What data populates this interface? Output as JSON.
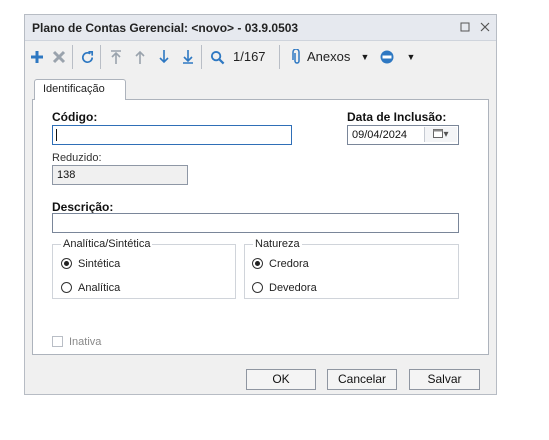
{
  "window": {
    "title": "Plano de Contas Gerencial: <novo> - 03.9.0503"
  },
  "titlebar": {
    "maximize_icon": "maximize-icon",
    "close_icon": "close-icon"
  },
  "toolbar": {
    "record_counter": "1/167",
    "attachments_label": "Anexos",
    "icons": [
      "add-icon",
      "delete-icon",
      "refresh-icon",
      "first-icon",
      "previous-icon",
      "next-icon",
      "last-icon",
      "search-icon",
      "paperclip-icon",
      "dropdown-icon",
      "report-icon",
      "dropdown-icon"
    ],
    "colors": {
      "add": "#2e78c2",
      "nav": "#2e78c2",
      "delete": "#9aa3ad"
    }
  },
  "tabs": [
    {
      "label": "Identificação",
      "active": true
    }
  ],
  "form": {
    "codigo": {
      "label": "Código:",
      "value": ""
    },
    "data_inclusao": {
      "label": "Data de Inclusão:",
      "value": "09/04/2024"
    },
    "reduzido": {
      "label": "Reduzido:",
      "value": "138"
    },
    "descricao": {
      "label": "Descrição:",
      "value": ""
    },
    "analitica_sintetica": {
      "legend": "Analítica/Sintética",
      "options": [
        {
          "label": "Sintética",
          "selected": true
        },
        {
          "label": "Analítica",
          "selected": false
        }
      ]
    },
    "natureza": {
      "legend": "Natureza",
      "options": [
        {
          "label": "Credora",
          "selected": true
        },
        {
          "label": "Devedora",
          "selected": false
        }
      ]
    },
    "inativa": {
      "label": "Inativa",
      "checked": false,
      "disabled": true
    }
  },
  "footer": {
    "ok_label": "OK",
    "cancel_label": "Cancelar",
    "save_label": "Salvar"
  }
}
